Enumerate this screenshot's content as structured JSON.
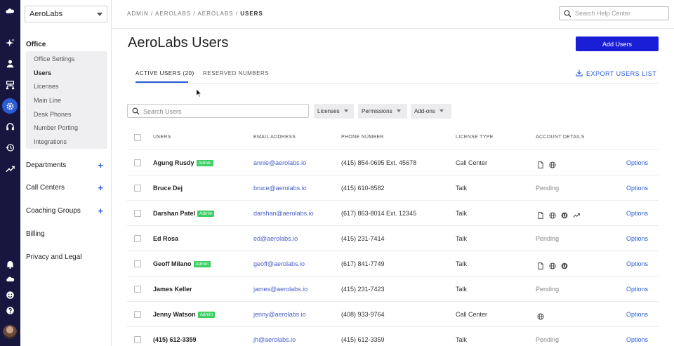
{
  "sidebar": {
    "org_select": "AeroLabs",
    "office_label": "Office",
    "office_items": [
      "Office Settings",
      "Users",
      "Licenses",
      "Main Line",
      "Desk Phones",
      "Number Porting",
      "Integrations"
    ],
    "active_item": "Users",
    "sections": [
      "Departments",
      "Call Centers",
      "Coaching Groups",
      "Billing",
      "Privacy and Legal"
    ]
  },
  "rail": {
    "icons": [
      "logo-icon",
      "sparkle-icon",
      "person-icon",
      "org-chart-icon",
      "settings-icon",
      "headset-icon",
      "history-icon",
      "analytics-icon",
      "bell-icon",
      "cloud-icon",
      "smiley-icon",
      "help-icon"
    ],
    "active_icon": "settings-icon"
  },
  "header": {
    "breadcrumb": [
      "ADMIN",
      "AEROLABS",
      "AEROLABS"
    ],
    "breadcrumb_current": "USERS",
    "help_search_placeholder": "Search Help Center"
  },
  "main": {
    "title": "AeroLabs Users",
    "add_button": "Add Users",
    "tabs": [
      "ACTIVE USERS (20)",
      "RESERVED NUMBERS"
    ],
    "export": "EXPORT USERS LIST",
    "search_placeholder": "Search Users",
    "filters": [
      "Licenses",
      "Permissions",
      "Add-ons"
    ]
  },
  "table": {
    "headers": [
      "USERS",
      "EMAIL ADDRESS",
      "PHONE NUMBER",
      "LICENSE TYPE",
      "ACCOUNT DETAILS"
    ],
    "admin_badge": "Admin",
    "options_label": "Options",
    "pending_label": "Pending",
    "rows": [
      {
        "name": "Agung Rusdy",
        "admin": true,
        "email": "annie@aerolabs.io",
        "phone": "(415) 854-0695 Ext. 45678",
        "license": "Call Center",
        "details": [
          "document-icon",
          "globe-icon"
        ]
      },
      {
        "name": "Bruce Dej",
        "admin": false,
        "email": "bruce@aerolabs.io",
        "phone": "(415) 610-8582",
        "license": "Talk",
        "details": [
          "pending"
        ]
      },
      {
        "name": "Darshan Patel",
        "admin": true,
        "email": "darshan@aerolabs.io",
        "phone": "(617) 863-8014 Ext. 12345",
        "license": "Talk",
        "details": [
          "document-icon",
          "globe-icon",
          "badge-icon",
          "trend-icon"
        ]
      },
      {
        "name": "Ed Rosa",
        "admin": false,
        "email": "ed@aerolabs.io",
        "phone": "(415) 231-7414",
        "license": "Talk",
        "details": [
          "pending"
        ]
      },
      {
        "name": "Geoff Milano",
        "admin": true,
        "email": "geoff@aerolabs.io",
        "phone": "(617) 841-7749",
        "license": "Talk",
        "details": [
          "document-icon",
          "globe-icon",
          "badge-icon"
        ]
      },
      {
        "name": "James Keller",
        "admin": false,
        "email": "james@aerolabs.io",
        "phone": "(415) 231-7423",
        "license": "Talk",
        "details": [
          "pending"
        ]
      },
      {
        "name": "Jenny Watson",
        "admin": true,
        "email": "jenny@aerolabs.io",
        "phone": "(408) 933-9764",
        "license": "Call Center",
        "details": [
          "globe-icon"
        ]
      },
      {
        "name": "(415) 612-3359",
        "admin": false,
        "email": "jh@aerolabs.io",
        "phone": "(415) 612-3359",
        "license": "Talk",
        "details": [
          "pending"
        ]
      }
    ]
  },
  "colors": {
    "rail_bg": "#16163f",
    "accent": "#2c5cd6",
    "primary_button": "#1a1ed6",
    "admin_badge": "#3ccf64"
  }
}
